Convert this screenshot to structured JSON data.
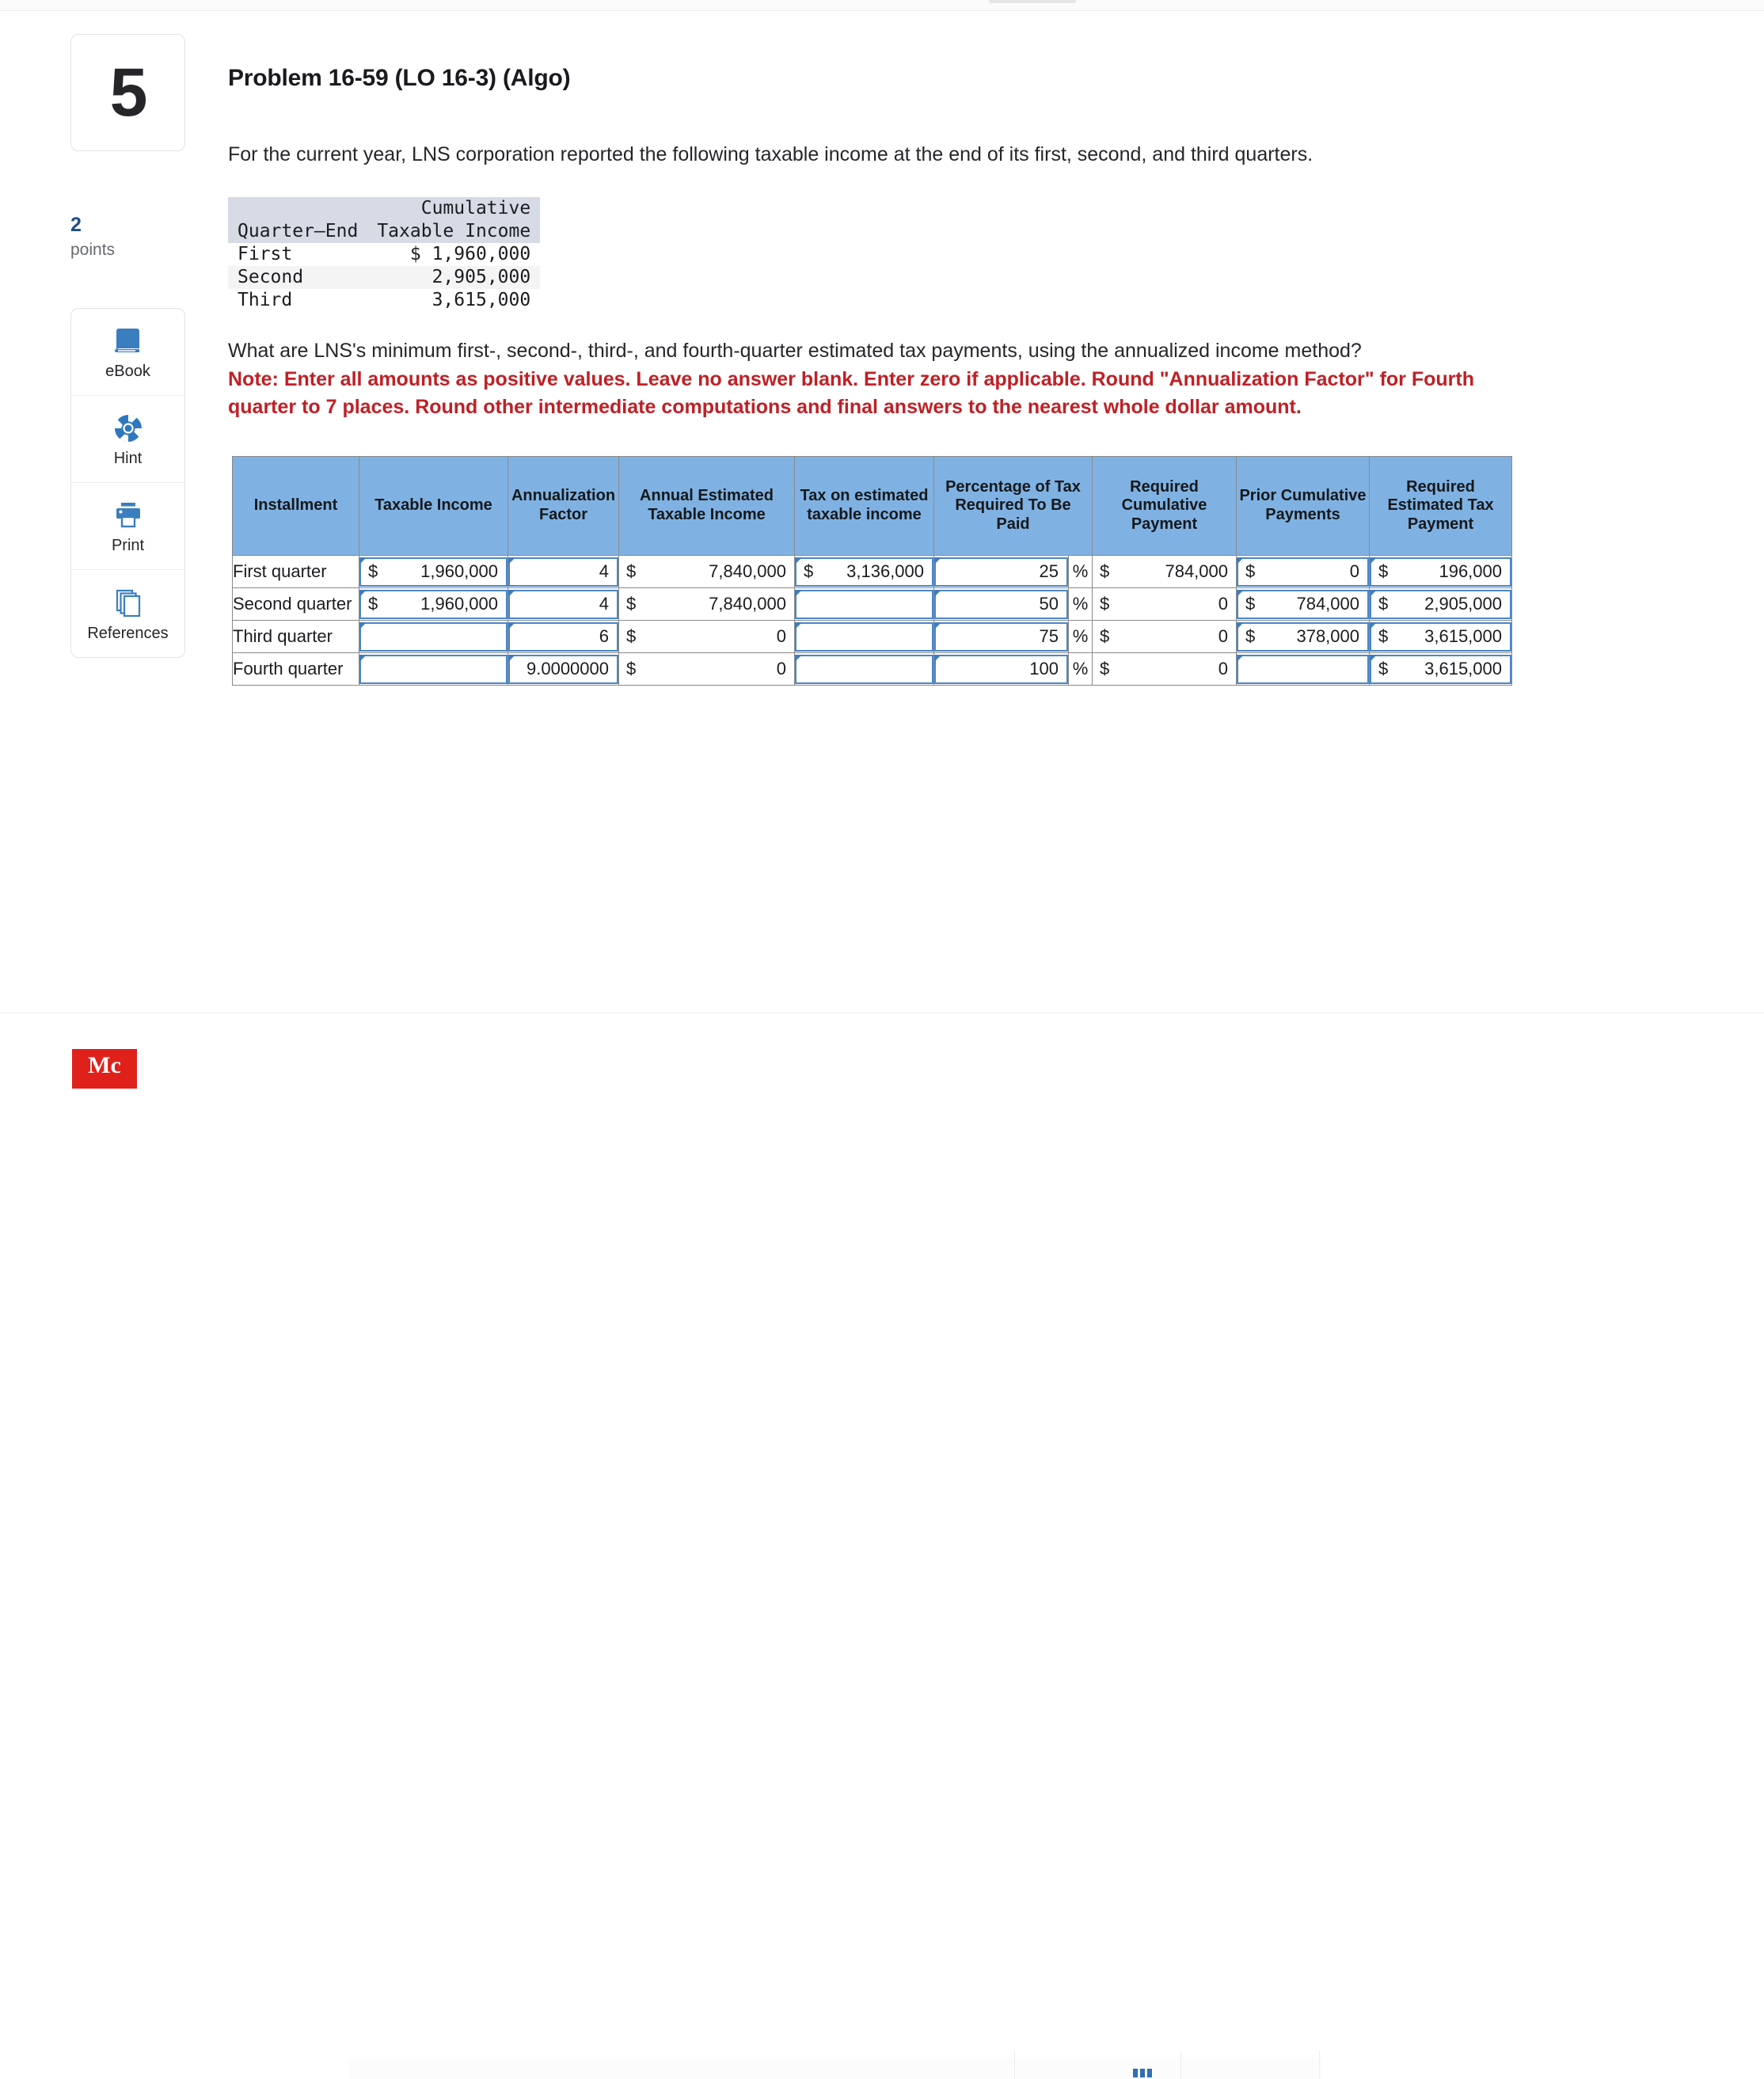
{
  "question_number": "5",
  "points": {
    "value": "2",
    "label": "points"
  },
  "tools": [
    {
      "label": "eBook",
      "icon": "ebook-icon"
    },
    {
      "label": "Hint",
      "icon": "hint-icon"
    },
    {
      "label": "Print",
      "icon": "print-icon"
    },
    {
      "label": "References",
      "icon": "references-icon"
    }
  ],
  "problem": {
    "title": "Problem 16-59 (LO 16-3) (Algo)",
    "intro": "For the current year, LNS corporation reported the following taxable income at the end of its first, second, and third quarters.",
    "question": "What are LNS's minimum first-, second-, third-, and fourth-quarter estimated tax payments, using the annualized income method?",
    "note": "Note: Enter all amounts as positive values. Leave no answer blank. Enter zero if applicable. Round \"Annualization Factor\" for Fourth quarter to 7 places. Round other intermediate computations and final answers to the nearest whole dollar amount."
  },
  "facts_table": {
    "headers": {
      "col1_line1": "",
      "col1_line2": "Quarter–End",
      "col2_line1": "Cumulative",
      "col2_line2": "Taxable Income"
    },
    "rows": [
      {
        "quarter": "First",
        "amount": "$ 1,960,000"
      },
      {
        "quarter": "Second",
        "amount": "2,905,000"
      },
      {
        "quarter": "Third",
        "amount": "3,615,000"
      }
    ]
  },
  "answer_table": {
    "headers": [
      "Installment",
      "Taxable Income",
      "Annualization Factor",
      "Annual Estimated Taxable Income",
      "Tax on estimated taxable income",
      "Percentage of Tax Required To Be Paid",
      "",
      "Required Cumulative Payment",
      "Prior Cumulative Payments",
      "Required Estimated Tax Payment"
    ],
    "rows": [
      {
        "installment": "First quarter",
        "taxable_income": {
          "currency": "$",
          "value": "1,960,000",
          "editable": true
        },
        "annualization": {
          "currency": "",
          "value": "4",
          "editable": true
        },
        "annual_estimated": {
          "currency": "$",
          "value": "7,840,000",
          "editable": false
        },
        "tax_on_estimated": {
          "currency": "$",
          "value": "3,136,000",
          "editable": true
        },
        "percentage": {
          "currency": "",
          "value": "25",
          "editable": true
        },
        "percent_sign": "%",
        "required_cumulative": {
          "currency": "$",
          "value": "784,000",
          "editable": false
        },
        "prior_cumulative": {
          "currency": "$",
          "value": "0",
          "editable": true
        },
        "required_estimated": {
          "currency": "$",
          "value": "196,000",
          "editable": true
        }
      },
      {
        "installment": "Second quarter",
        "taxable_income": {
          "currency": "$",
          "value": "1,960,000",
          "editable": true
        },
        "annualization": {
          "currency": "",
          "value": "4",
          "editable": true
        },
        "annual_estimated": {
          "currency": "$",
          "value": "7,840,000",
          "editable": false
        },
        "tax_on_estimated": {
          "currency": "",
          "value": "",
          "editable": true
        },
        "percentage": {
          "currency": "",
          "value": "50",
          "editable": true
        },
        "percent_sign": "%",
        "required_cumulative": {
          "currency": "$",
          "value": "0",
          "editable": false
        },
        "prior_cumulative": {
          "currency": "$",
          "value": "784,000",
          "editable": true
        },
        "required_estimated": {
          "currency": "$",
          "value": "2,905,000",
          "editable": true
        }
      },
      {
        "installment": "Third quarter",
        "taxable_income": {
          "currency": "",
          "value": "",
          "editable": true
        },
        "annualization": {
          "currency": "",
          "value": "6",
          "editable": true
        },
        "annual_estimated": {
          "currency": "$",
          "value": "0",
          "editable": false
        },
        "tax_on_estimated": {
          "currency": "",
          "value": "",
          "editable": true
        },
        "percentage": {
          "currency": "",
          "value": "75",
          "editable": true
        },
        "percent_sign": "%",
        "required_cumulative": {
          "currency": "$",
          "value": "0",
          "editable": false
        },
        "prior_cumulative": {
          "currency": "$",
          "value": "378,000",
          "editable": true
        },
        "required_estimated": {
          "currency": "$",
          "value": "3,615,000",
          "editable": true
        }
      },
      {
        "installment": "Fourth quarter",
        "taxable_income": {
          "currency": "",
          "value": "",
          "editable": true
        },
        "annualization": {
          "currency": "",
          "value": "9.0000000",
          "editable": true
        },
        "annual_estimated": {
          "currency": "$",
          "value": "0",
          "editable": false
        },
        "tax_on_estimated": {
          "currency": "",
          "value": "",
          "editable": true
        },
        "percentage": {
          "currency": "",
          "value": "100",
          "editable": true
        },
        "percent_sign": "%",
        "required_cumulative": {
          "currency": "$",
          "value": "0",
          "editable": false
        },
        "prior_cumulative": {
          "currency": "",
          "value": "",
          "editable": true
        },
        "required_estimated": {
          "currency": "$",
          "value": "3,615,000",
          "editable": true
        }
      }
    ]
  },
  "footer": {
    "logo_text": "Mc"
  },
  "colors": {
    "header_blue": "#7fb2e3",
    "input_border": "#4a86c8",
    "note_red": "#bf2026",
    "points_blue": "#1b4f87",
    "facts_header_bg": "#d6dbe6",
    "logo_red": "#e0201b"
  }
}
